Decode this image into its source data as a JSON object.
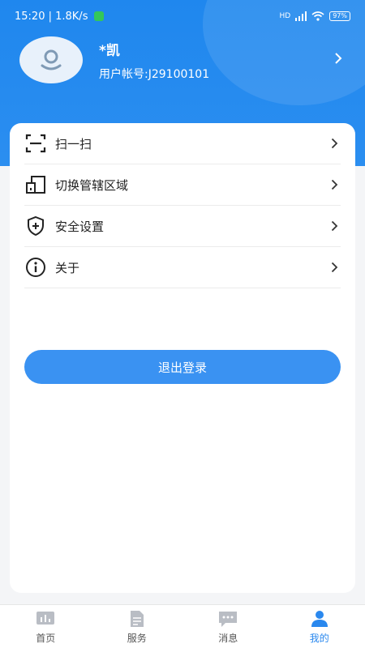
{
  "status_bar": {
    "time_speed": "15:20 | 1.8K/s",
    "signal": "HD",
    "battery": "97%"
  },
  "profile": {
    "name": "*凯",
    "account": "用户帐号:J29100101"
  },
  "menu": {
    "items": [
      {
        "label": "扫一扫",
        "icon": "scan-icon"
      },
      {
        "label": "切换管辖区域",
        "icon": "switch-area-icon"
      },
      {
        "label": "安全设置",
        "icon": "shield-plus-icon"
      },
      {
        "label": "关于",
        "icon": "info-icon"
      }
    ]
  },
  "logout_label": "退出登录",
  "tabbar": {
    "tabs": [
      {
        "label": "首页",
        "icon": "home-icon",
        "active": false
      },
      {
        "label": "服务",
        "icon": "document-icon",
        "active": false
      },
      {
        "label": "消息",
        "icon": "message-icon",
        "active": false
      },
      {
        "label": "我的",
        "icon": "user-icon",
        "active": true
      }
    ]
  },
  "colors": {
    "primary": "#2b8ef0",
    "button": "#3a92f2",
    "active_tab": "#2a88ee",
    "inactive_icon": "#b9bdc4"
  }
}
